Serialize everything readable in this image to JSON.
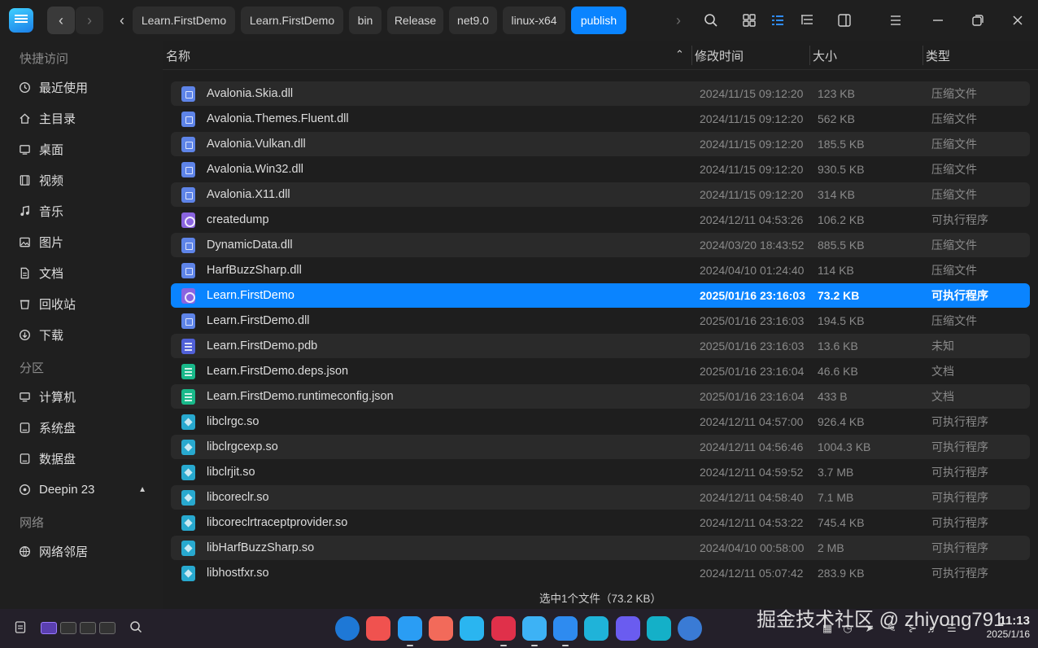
{
  "breadcrumbs": [
    "Learn.FirstDemo",
    "Learn.FirstDemo",
    "bin",
    "Release",
    "net9.0",
    "linux-x64",
    "publish"
  ],
  "toolbar": {
    "icons": [
      "search-icon",
      "icon-view-icon",
      "list-view-icon",
      "tree-view-icon",
      "detail-panel-icon",
      "menu-icon",
      "minimize-icon",
      "maximize-icon",
      "close-icon"
    ]
  },
  "sidebar": {
    "quick_access_title": "快捷访问",
    "quick_access": [
      {
        "label": "最近使用",
        "icon": "clock-icon"
      },
      {
        "label": "主目录",
        "icon": "home-icon"
      },
      {
        "label": "桌面",
        "icon": "desktop-icon"
      },
      {
        "label": "视频",
        "icon": "video-icon"
      },
      {
        "label": "音乐",
        "icon": "music-icon"
      },
      {
        "label": "图片",
        "icon": "image-icon"
      },
      {
        "label": "文档",
        "icon": "document-icon"
      },
      {
        "label": "回收站",
        "icon": "trash-icon"
      },
      {
        "label": "下载",
        "icon": "download-icon"
      }
    ],
    "partitions_title": "分区",
    "partitions": [
      {
        "label": "计算机",
        "icon": "computer-icon"
      },
      {
        "label": "系统盘",
        "icon": "disk-icon"
      },
      {
        "label": "数据盘",
        "icon": "disk-icon"
      },
      {
        "label": "Deepin 23",
        "icon": "optical-disc-icon"
      }
    ],
    "network_title": "网络",
    "network": [
      {
        "label": "网络邻居",
        "icon": "network-icon"
      }
    ]
  },
  "columns": {
    "name": "名称",
    "modified": "修改时间",
    "size": "大小",
    "type": "类型"
  },
  "files": [
    {
      "name": "Avalonia.Skia.dll",
      "time": "2024/11/15 09:12:20",
      "size": "123 KB",
      "type": "压缩文件",
      "icon": "zip"
    },
    {
      "name": "Avalonia.Themes.Fluent.dll",
      "time": "2024/11/15 09:12:20",
      "size": "562 KB",
      "type": "压缩文件",
      "icon": "zip"
    },
    {
      "name": "Avalonia.Vulkan.dll",
      "time": "2024/11/15 09:12:20",
      "size": "185.5 KB",
      "type": "压缩文件",
      "icon": "zip"
    },
    {
      "name": "Avalonia.Win32.dll",
      "time": "2024/11/15 09:12:20",
      "size": "930.5 KB",
      "type": "压缩文件",
      "icon": "zip"
    },
    {
      "name": "Avalonia.X11.dll",
      "time": "2024/11/15 09:12:20",
      "size": "314 KB",
      "type": "压缩文件",
      "icon": "zip"
    },
    {
      "name": "createdump",
      "time": "2024/12/11 04:53:26",
      "size": "106.2 KB",
      "type": "可执行程序",
      "icon": "exe"
    },
    {
      "name": "DynamicData.dll",
      "time": "2024/03/20 18:43:52",
      "size": "885.5 KB",
      "type": "压缩文件",
      "icon": "zip"
    },
    {
      "name": "HarfBuzzSharp.dll",
      "time": "2024/04/10 01:24:40",
      "size": "114 KB",
      "type": "压缩文件",
      "icon": "zip"
    },
    {
      "name": "Learn.FirstDemo",
      "time": "2025/01/16 23:16:03",
      "size": "73.2 KB",
      "type": "可执行程序",
      "icon": "exe",
      "selected": true
    },
    {
      "name": "Learn.FirstDemo.dll",
      "time": "2025/01/16 23:16:03",
      "size": "194.5 KB",
      "type": "压缩文件",
      "icon": "zip"
    },
    {
      "name": "Learn.FirstDemo.pdb",
      "time": "2025/01/16 23:16:03",
      "size": "13.6 KB",
      "type": "未知",
      "icon": "pdb"
    },
    {
      "name": "Learn.FirstDemo.deps.json",
      "time": "2025/01/16 23:16:04",
      "size": "46.6 KB",
      "type": "文档",
      "icon": "doc"
    },
    {
      "name": "Learn.FirstDemo.runtimeconfig.json",
      "time": "2025/01/16 23:16:04",
      "size": "433 B",
      "type": "文档",
      "icon": "doc"
    },
    {
      "name": "libclrgc.so",
      "time": "2024/12/11 04:57:00",
      "size": "926.4 KB",
      "type": "可执行程序",
      "icon": "so"
    },
    {
      "name": "libclrgcexp.so",
      "time": "2024/12/11 04:56:46",
      "size": "1004.3 KB",
      "type": "可执行程序",
      "icon": "so"
    },
    {
      "name": "libclrjit.so",
      "time": "2024/12/11 04:59:52",
      "size": "3.7 MB",
      "type": "可执行程序",
      "icon": "so"
    },
    {
      "name": "libcoreclr.so",
      "time": "2024/12/11 04:58:40",
      "size": "7.1 MB",
      "type": "可执行程序",
      "icon": "so"
    },
    {
      "name": "libcoreclrtraceptprovider.so",
      "time": "2024/12/11 04:53:22",
      "size": "745.4 KB",
      "type": "可执行程序",
      "icon": "so"
    },
    {
      "name": "libHarfBuzzSharp.so",
      "time": "2024/04/10 00:58:00",
      "size": "2 MB",
      "type": "可执行程序",
      "icon": "so"
    },
    {
      "name": "libhostfxr.so",
      "time": "2024/12/11 05:07:42",
      "size": "283.9 KB",
      "type": "可执行程序",
      "icon": "so"
    }
  ],
  "status": "选中1个文件（73.2 KB）",
  "taskbar": {
    "dock_colors": [
      "#1e78d6",
      "#f0524f",
      "#2a9df4",
      "#f26a5a",
      "#2ab5f0",
      "#e0304a",
      "#3db2f5",
      "#2e8bf0",
      "#1fb3d9",
      "#6a5cf0",
      "#14b0c8",
      "#3a7bd5"
    ],
    "clock_time": "11:13",
    "clock_date": "2025/1/16"
  },
  "watermark": "掘金技术社区 @ zhiyong791"
}
